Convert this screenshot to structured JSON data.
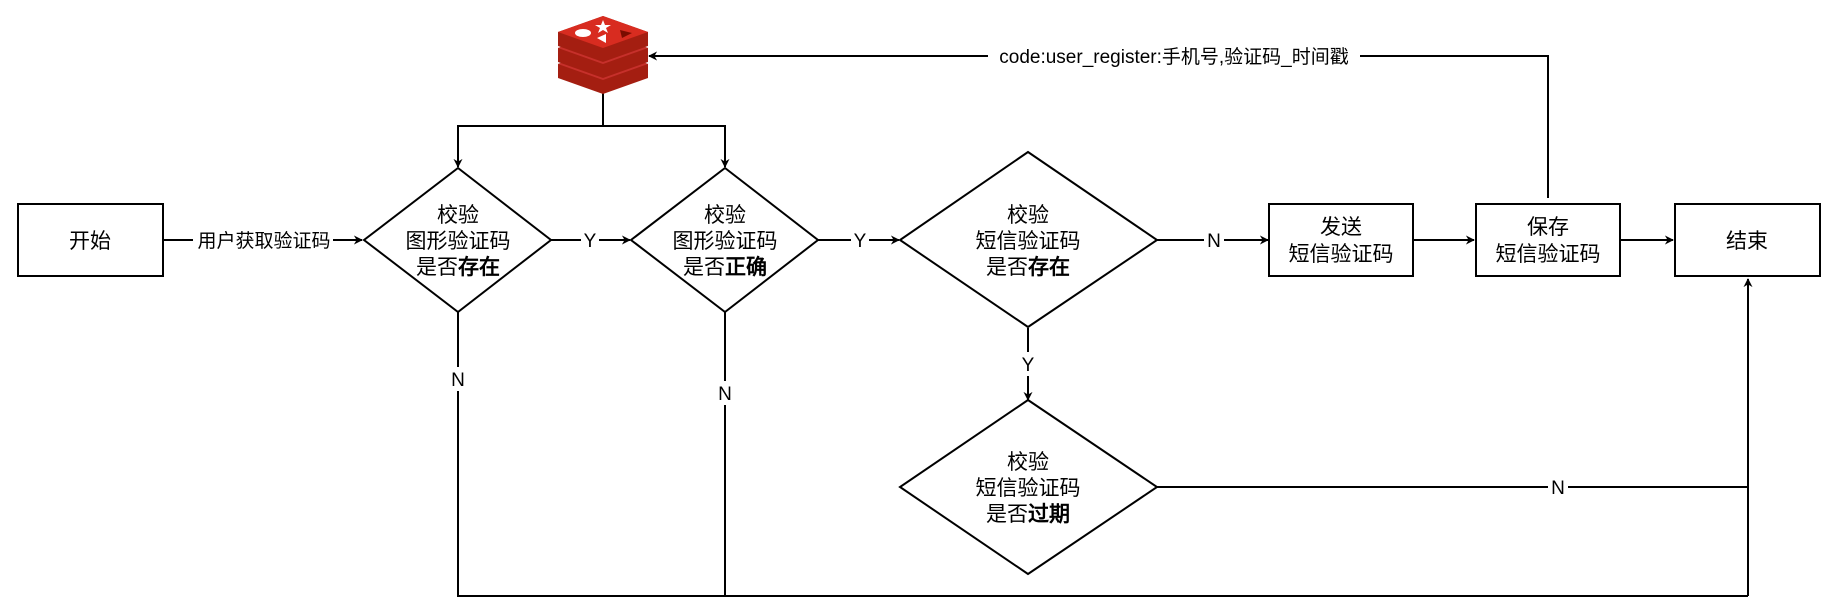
{
  "nodes": {
    "start": {
      "label": "开始"
    },
    "end": {
      "label": "结束"
    },
    "check_img_exist": {
      "line1": "校验",
      "line2": "图形验证码",
      "line3_prefix": "是否",
      "line3_bold": "存在"
    },
    "check_img_correct": {
      "line1": "校验",
      "line2": "图形验证码",
      "line3_prefix": "是否",
      "line3_bold": "正确"
    },
    "check_sms_exist": {
      "line1": "校验",
      "line2": "短信验证码",
      "line3_prefix": "是否",
      "line3_bold": "存在"
    },
    "check_sms_expired": {
      "line1": "校验",
      "line2": "短信验证码",
      "line3_prefix": "是否",
      "line3_bold": "过期"
    },
    "send_sms": {
      "line1": "发送",
      "line2": "短信验证码"
    },
    "save_sms": {
      "line1": "保存",
      "line2": "短信验证码"
    }
  },
  "edges": {
    "get_code": "用户获取验证码",
    "y1": "Y",
    "y2": "Y",
    "y3": "Y",
    "n_img_exist": "N",
    "n_img_correct": "N",
    "n_sms_exist": "N",
    "n_sms_expired": "N",
    "redis_key": "code:user_register:手机号,验证码_时间戳"
  },
  "icons": {
    "cache": "redis-logo-icon"
  },
  "colors": {
    "redis_red": "#c6302b",
    "redis_dark": "#a41e11",
    "stroke": "#000000"
  }
}
